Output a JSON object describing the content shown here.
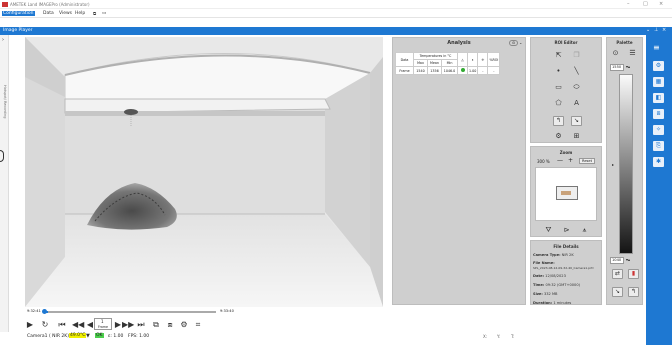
{
  "window": {
    "title": "AMETEK Land IMAGEPro (Administrator)"
  },
  "menu": [
    "Configuration",
    "Data",
    "Views",
    "Help"
  ],
  "tab": {
    "label": "Image Player"
  },
  "side": {
    "label": "Hotspot/ Recording"
  },
  "analysis": {
    "title": "Analysis",
    "temp_header": "Temperatures in °C",
    "headers": [
      "Data",
      "Max",
      "Mean",
      "Min",
      "%ROI"
    ],
    "row": {
      "name": "Frame",
      "max": "1540",
      "mean": "1356",
      "min": "1046.0",
      "val": "1.00",
      "d1": "-",
      "d2": "-"
    }
  },
  "roi": {
    "title": "ROI Editor"
  },
  "zoom": {
    "title": "Zoom",
    "level": "300 %",
    "reset": "Reset"
  },
  "file": {
    "title": "File Details",
    "camera_label": "Camera Type:",
    "camera_value": "NIR 2K",
    "name_label": "File Name:",
    "name_value": "SPL_2023-08-12-09-32-40_Camera1.prfc",
    "date_label": "Date:",
    "date_value": "12/08/2023",
    "time_label": "Time:",
    "time_value": "09:32 (GMT+0000)",
    "size_label": "Size:",
    "size_value": "332 MB",
    "dur_label": "Duration:",
    "dur_value": "1 minutes"
  },
  "palette": {
    "title": "Palette",
    "max": "1550",
    "min": "1040"
  },
  "timeline": {
    "start": "9:32:41",
    "end": "9:33:40",
    "frame_value": "1",
    "frame_label": "Frame"
  },
  "status": {
    "camera": "Camera1 ( NIR 2K)",
    "temp": "49.0°C",
    "ok": "OK",
    "emiss": "ε: 1.00",
    "fps": "FPS: 1.00",
    "x": "X:",
    "y": "Y:",
    "t": "T:"
  },
  "colors": {
    "accent": "#1e78d2",
    "temp_bg": "#f0f000",
    "ok_bg": "#4ccf4c"
  }
}
